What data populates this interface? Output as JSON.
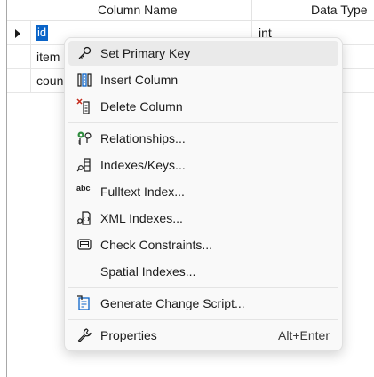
{
  "grid": {
    "headers": {
      "name": "Column Name",
      "type": "Data Type"
    },
    "rows": [
      {
        "name": "id",
        "type": "int"
      },
      {
        "name": "item",
        "type": ""
      },
      {
        "name": "coun",
        "type": ""
      }
    ]
  },
  "menu": {
    "items": [
      {
        "label": "Set Primary Key",
        "icon": "key-icon"
      },
      {
        "label": "Insert Column",
        "icon": "insert-column-icon"
      },
      {
        "label": "Delete Column",
        "icon": "delete-column-icon"
      },
      {
        "label": "Relationships...",
        "icon": "relationships-icon"
      },
      {
        "label": "Indexes/Keys...",
        "icon": "indexes-keys-icon"
      },
      {
        "label": "Fulltext Index...",
        "icon": "fulltext-index-icon"
      },
      {
        "label": "XML Indexes...",
        "icon": "xml-indexes-icon"
      },
      {
        "label": "Check Constraints...",
        "icon": "check-constraints-icon"
      },
      {
        "label": "Spatial Indexes...",
        "icon": ""
      },
      {
        "label": "Generate Change Script...",
        "icon": "generate-script-icon"
      },
      {
        "label": "Properties",
        "icon": "wrench-icon",
        "shortcut": "Alt+Enter"
      }
    ],
    "icon_text": {
      "fulltext": "abc"
    }
  },
  "colors": {
    "selection": "#0a64c8",
    "menu_bg": "#f9f9f9",
    "hover": "#eaeaea",
    "accent_green": "#2e8b3d",
    "accent_red": "#c42b1c"
  }
}
